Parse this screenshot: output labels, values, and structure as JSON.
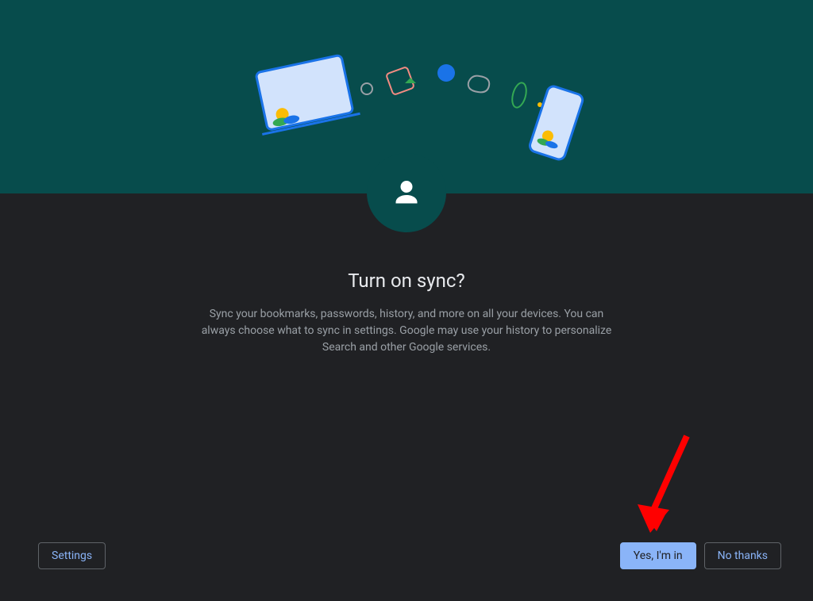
{
  "dialog": {
    "title": "Turn on sync?",
    "description": "Sync your bookmarks, passwords, history, and more on all your devices. You can always choose what to sync in settings. Google may use your history to personalize Search and other Google services."
  },
  "buttons": {
    "settings": "Settings",
    "yes": "Yes, I'm in",
    "no_thanks": "No thanks"
  }
}
